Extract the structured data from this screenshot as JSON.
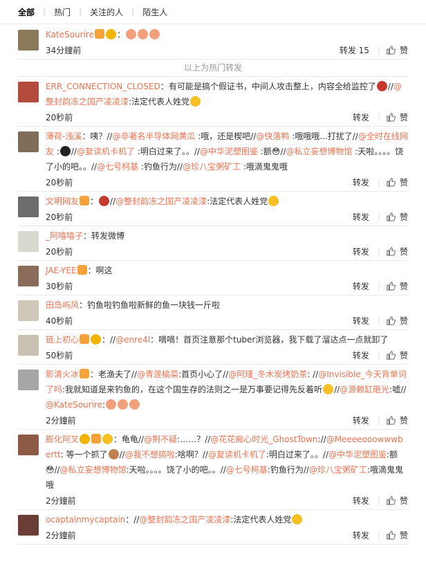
{
  "tabs": [
    "全部",
    "热门",
    "关注的人",
    "陌生人"
  ],
  "hot_divider": "以上为热门转发",
  "labels": {
    "repost": "转发",
    "like": "赞"
  },
  "items": [
    {
      "avatar_color": "#8a7a5a",
      "segments": [
        {
          "t": "name",
          "v": "KateSourire"
        },
        {
          "t": "badge",
          "c": "#f6a23a"
        },
        {
          "t": "emoji",
          "c": "#f2b400"
        },
        {
          "t": "plain",
          "v": "："
        },
        {
          "t": "emoji",
          "c": "#f2a07c"
        },
        {
          "t": "emoji",
          "c": "#f2a07c"
        },
        {
          "t": "emoji",
          "c": "#f2a07c"
        }
      ],
      "time": "34分鐘前",
      "repost": "转发 15",
      "like": "赞"
    },
    {
      "avatar_color": "#b24a3e",
      "segments": [
        {
          "t": "name",
          "v": "ERR_CONNECTION_CLOSED"
        },
        {
          "t": "plain",
          "v": "：有可能是搞个假证书，中间人攻击整上，内容全给监控了"
        },
        {
          "t": "emoji",
          "c": "#c6392f"
        },
        {
          "t": "plain",
          "v": "//"
        },
        {
          "t": "mention",
          "v": "@整封韵冻之国产凌凌漆"
        },
        {
          "t": "plain",
          "v": ":法定代表人姓党"
        },
        {
          "t": "emoji",
          "c": "#f5c023"
        }
      ],
      "time": "20秒前",
      "repost": "转发",
      "like": "赞"
    },
    {
      "avatar_color": "#7f6d5a",
      "segments": [
        {
          "t": "name",
          "v": "薄荷-浅溪"
        },
        {
          "t": "plain",
          "v": "：咦？//"
        },
        {
          "t": "mention",
          "v": "@非著名半导体网黄瓜"
        },
        {
          "t": "plain",
          "v": " :哦，还是楔吧//"
        },
        {
          "t": "mention",
          "v": "@快落鸭"
        },
        {
          "t": "plain",
          "v": " :哦哦哦...打扰了//"
        },
        {
          "t": "mention",
          "v": "@全时在线网友"
        },
        {
          "t": "plain",
          "v": " :"
        },
        {
          "t": "emoji",
          "c": "#222222"
        },
        {
          "t": "plain",
          "v": "//"
        },
        {
          "t": "mention",
          "v": "@复读机卡机了"
        },
        {
          "t": "plain",
          "v": " :明白过来了。。//"
        },
        {
          "t": "mention",
          "v": "@中华泥塑图鉴"
        },
        {
          "t": "plain",
          "v": " :额😳//"
        },
        {
          "t": "mention",
          "v": "@私立妄想博物馆"
        },
        {
          "t": "plain",
          "v": " :天啦。。。。饶了小的吧。。//"
        },
        {
          "t": "mention",
          "v": "@七号柯基"
        },
        {
          "t": "plain",
          "v": " :钓鱼行为//"
        },
        {
          "t": "mention",
          "v": "@珍八宝粥矿工"
        },
        {
          "t": "plain",
          "v": " :哦滴鬼鬼哦"
        }
      ],
      "time": "20秒前",
      "repost": "转发",
      "like": "赞"
    },
    {
      "avatar_color": "#6c6c6c",
      "segments": [
        {
          "t": "name",
          "v": "文明网友"
        },
        {
          "t": "badge",
          "c": "#f6a23a"
        },
        {
          "t": "plain",
          "v": "："
        },
        {
          "t": "emoji",
          "c": "#c6392f"
        },
        {
          "t": "plain",
          "v": "//"
        },
        {
          "t": "mention",
          "v": "@整封韵冻之国产凌凌漆"
        },
        {
          "t": "plain",
          "v": ":法定代表人姓党"
        },
        {
          "t": "emoji",
          "c": "#f5c023"
        }
      ],
      "time": "20秒前",
      "repost": "转发",
      "like": "赞"
    },
    {
      "avatar_color": "#d8d8d0",
      "segments": [
        {
          "t": "name",
          "v": "_阿嘻嘻子"
        },
        {
          "t": "plain",
          "v": "：转发微博"
        }
      ],
      "time": "20秒前",
      "repost": "转发",
      "like": "赞"
    },
    {
      "avatar_color": "#8b6b5a",
      "segments": [
        {
          "t": "name",
          "v": "JAE-YEE"
        },
        {
          "t": "badge",
          "c": "#f6a23a"
        },
        {
          "t": "plain",
          "v": "：啊这"
        }
      ],
      "time": "30秒前",
      "repost": "转发",
      "like": "赞"
    },
    {
      "avatar_color": "#cfc7b8",
      "segments": [
        {
          "t": "name",
          "v": "田岛屿风"
        },
        {
          "t": "plain",
          "v": "：钓鱼啦钓鱼啦新鲜的鱼一块钱一斤啦"
        }
      ],
      "time": "40秒前",
      "repost": "转发",
      "like": "赞"
    },
    {
      "avatar_color": "#c9c2b3",
      "segments": [
        {
          "t": "name",
          "v": "链上初心"
        },
        {
          "t": "badge",
          "c": "#f6a23a"
        },
        {
          "t": "emoji",
          "c": "#f2b400"
        },
        {
          "t": "plain",
          "v": "：//"
        },
        {
          "t": "mention",
          "v": "@enre4l"
        },
        {
          "t": "plain",
          "v": "：嘀嘀！首页注意那个tuber浏览器，我下载了溜达点一点就卸了"
        }
      ],
      "time": "50秒前",
      "repost": "转发",
      "like": "赞"
    },
    {
      "avatar_color": "#a6a6a6",
      "segments": [
        {
          "t": "name",
          "v": "影清火冰"
        },
        {
          "t": "badge",
          "c": "#f6a23a"
        },
        {
          "t": "plain",
          "v": "：老渔夫了//"
        },
        {
          "t": "mention",
          "v": "@青莲榆菜"
        },
        {
          "t": "plain",
          "v": ":首页小心了//"
        },
        {
          "t": "mention",
          "v": "@阿瑾_冬木炭烤奶茶"
        },
        {
          "t": "plain",
          "v": ": //"
        },
        {
          "t": "mention",
          "v": "@Invisible_今天背单词了吗"
        },
        {
          "t": "plain",
          "v": ":我就知道是来钓鱼的，在这个国生存的法则之一是万事要记得先反着听"
        },
        {
          "t": "emoji",
          "c": "#f5c023"
        },
        {
          "t": "plain",
          "v": "//"
        },
        {
          "t": "mention",
          "v": "@源赖缸砸光"
        },
        {
          "t": "plain",
          "v": ":嘘//"
        },
        {
          "t": "mention",
          "v": "@KateSourire"
        },
        {
          "t": "plain",
          "v": ":"
        },
        {
          "t": "emoji",
          "c": "#f2a07c"
        },
        {
          "t": "emoji",
          "c": "#f2a07c"
        },
        {
          "t": "emoji",
          "c": "#f2a07c"
        }
      ],
      "time": "2分鐘前",
      "repost": "转发",
      "like": "赞"
    },
    {
      "avatar_color": "#8c5a45",
      "segments": [
        {
          "t": "name",
          "v": "膨化阿叉"
        },
        {
          "t": "emoji",
          "c": "#f2b400"
        },
        {
          "t": "badge",
          "c": "#f6a23a"
        },
        {
          "t": "emoji",
          "c": "#f5c023"
        },
        {
          "t": "plain",
          "v": "：龟龟//"
        },
        {
          "t": "mention",
          "v": "@荆不疑"
        },
        {
          "t": "plain",
          "v": ":……？//"
        },
        {
          "t": "mention",
          "v": "@花花痴心时光_GhostTown"
        },
        {
          "t": "plain",
          "v": "://"
        },
        {
          "t": "mention",
          "v": "@Meeeeooowwwbertt"
        },
        {
          "t": "plain",
          "v": ": 等一个抓了"
        },
        {
          "t": "emoji",
          "c": "#c08050"
        },
        {
          "t": "plain",
          "v": "//"
        },
        {
          "t": "mention",
          "v": "@我不想搞啦"
        },
        {
          "t": "plain",
          "v": ":啥啊？//"
        },
        {
          "t": "mention",
          "v": "@复读机卡机了"
        },
        {
          "t": "plain",
          "v": ":明白过来了。。//"
        },
        {
          "t": "mention",
          "v": "@中华泥塑图鉴"
        },
        {
          "t": "plain",
          "v": ":额😳//"
        },
        {
          "t": "mention",
          "v": "@私立妄想博物馆"
        },
        {
          "t": "plain",
          "v": ":天啦。。。。饶了小的吧。。//"
        },
        {
          "t": "mention",
          "v": "@七号柯基"
        },
        {
          "t": "plain",
          "v": ":钓鱼行为//"
        },
        {
          "t": "mention",
          "v": "@珍八宝粥矿工"
        },
        {
          "t": "plain",
          "v": ":哦滴鬼鬼哦"
        }
      ],
      "time": "2分鐘前",
      "repost": "转发",
      "like": "赞"
    },
    {
      "avatar_color": "#6a3d35",
      "segments": [
        {
          "t": "name",
          "v": "ocaptainmycaptain"
        },
        {
          "t": "plain",
          "v": "：//"
        },
        {
          "t": "mention",
          "v": "@整封韵冻之国产凌凌漆"
        },
        {
          "t": "plain",
          "v": ":法定代表人姓党"
        },
        {
          "t": "emoji",
          "c": "#f5c023"
        }
      ],
      "time": "2分鐘前",
      "repost": "转发",
      "like": "赞"
    }
  ]
}
